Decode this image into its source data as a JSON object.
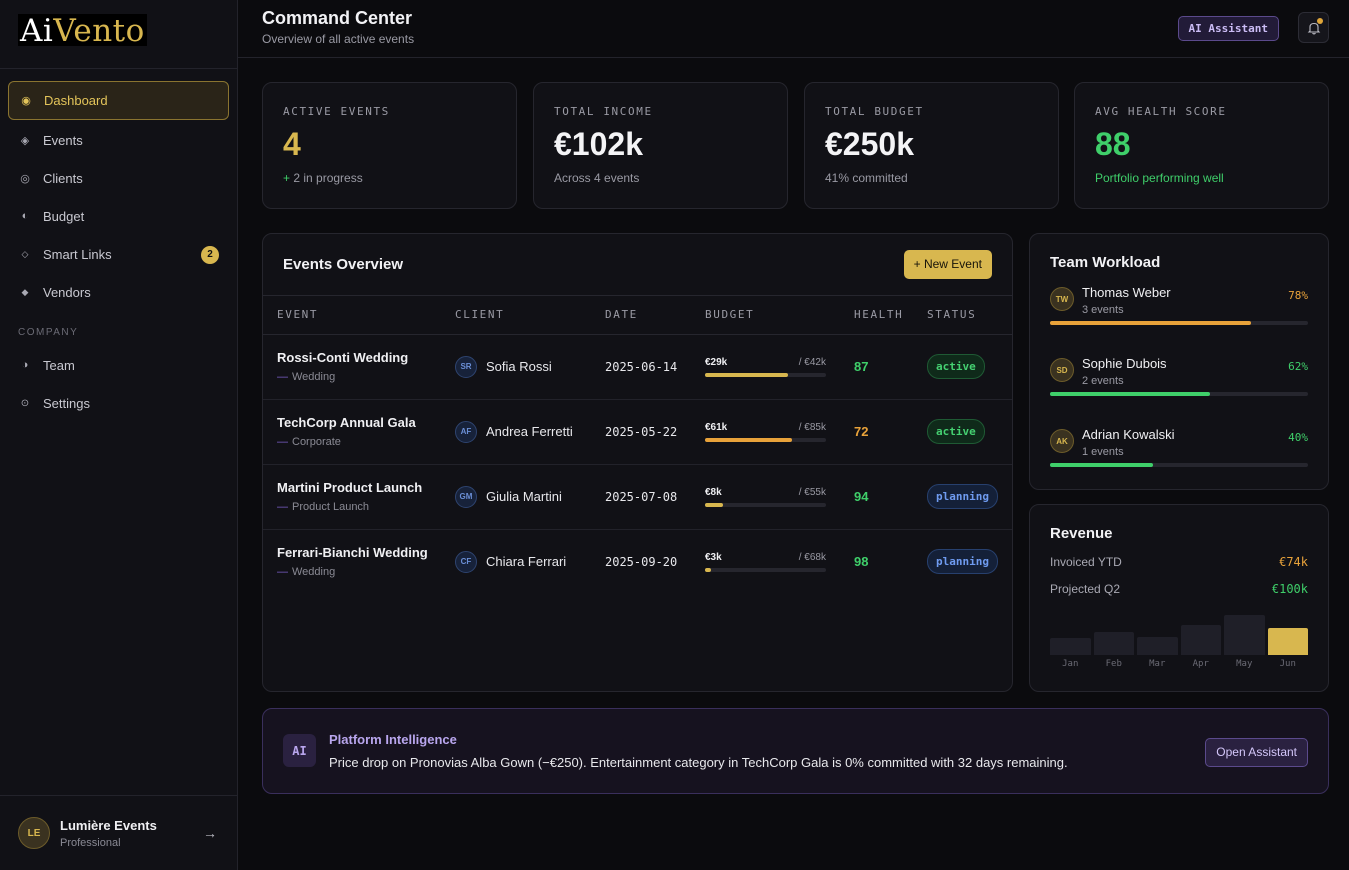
{
  "brand": {
    "logo_ai": "Ai",
    "logo_vento": "Vento"
  },
  "sidebar": {
    "items": [
      {
        "label": "Dashboard",
        "icon": "target-icon"
      },
      {
        "label": "Events",
        "icon": "diamond-icon"
      },
      {
        "label": "Clients",
        "icon": "ring-icon"
      },
      {
        "label": "Budget",
        "icon": "half-circle-icon"
      },
      {
        "label": "Smart Links",
        "icon": "diamond-outline-icon",
        "badge": "2"
      },
      {
        "label": "Vendors",
        "icon": "diamond-small-icon"
      }
    ],
    "section_company": "COMPANY",
    "company_items": [
      {
        "label": "Team",
        "icon": "half-circle-icon"
      },
      {
        "label": "Settings",
        "icon": "gear-icon"
      }
    ],
    "user": {
      "initials": "LE",
      "name": "Lumière Events",
      "plan": "Professional",
      "logout_glyph": "→"
    }
  },
  "header": {
    "title": "Command Center",
    "subtitle": "Overview of all active events",
    "ai_button": "AI Assistant"
  },
  "stats": [
    {
      "label": "ACTIVE EVENTS",
      "value": "4",
      "sub_prefix": "+",
      "sub": "2 in progress"
    },
    {
      "label": "TOTAL INCOME",
      "value": "€102k",
      "sub": "Across 4 events"
    },
    {
      "label": "TOTAL BUDGET",
      "value": "€250k",
      "sub": "41% committed"
    },
    {
      "label": "AVG HEALTH SCORE",
      "value": "88",
      "sub": "Portfolio performing well"
    }
  ],
  "events": {
    "title": "Events Overview",
    "new_button": "+ New Event",
    "columns": [
      "EVENT",
      "CLIENT",
      "DATE",
      "BUDGET",
      "HEALTH",
      "STATUS"
    ],
    "rows": [
      {
        "name": "Rossi-Conti Wedding",
        "type": "Wedding",
        "client_initials": "SR",
        "client": "Sofia Rossi",
        "date": "2025-06-14",
        "spent": "€29k",
        "total": "/ €42k",
        "pct": 0.69,
        "health": "87",
        "status": "active",
        "color": "#d8b74f"
      },
      {
        "name": "TechCorp Annual Gala",
        "type": "Corporate",
        "client_initials": "AF",
        "client": "Andrea Ferretti",
        "date": "2025-05-22",
        "spent": "€61k",
        "total": "/ €85k",
        "pct": 0.72,
        "health": "72",
        "status": "active",
        "color": "#e8a23a"
      },
      {
        "name": "Martini Product Launch",
        "type": "Product Launch",
        "client_initials": "GM",
        "client": "Giulia Martini",
        "date": "2025-07-08",
        "spent": "€8k",
        "total": "/ €55k",
        "pct": 0.15,
        "health": "94",
        "status": "planning",
        "color": "#d8b74f"
      },
      {
        "name": "Ferrari-Bianchi Wedding",
        "type": "Wedding",
        "client_initials": "CF",
        "client": "Chiara Ferrari",
        "date": "2025-09-20",
        "spent": "€3k",
        "total": "/ €68k",
        "pct": 0.05,
        "health": "98",
        "status": "planning",
        "color": "#d8b74f"
      }
    ]
  },
  "team": {
    "title": "Team Workload",
    "members": [
      {
        "initials": "TW",
        "name": "Thomas Weber",
        "sub": "3 events",
        "pct_label": "78%",
        "pct": 0.78,
        "color": "#e8a23a"
      },
      {
        "initials": "SD",
        "name": "Sophie Dubois",
        "sub": "2 events",
        "pct_label": "62%",
        "pct": 0.62,
        "color": "#3fcf6a"
      },
      {
        "initials": "AK",
        "name": "Adrian Kowalski",
        "sub": "1 events",
        "pct_label": "40%",
        "pct": 0.4,
        "color": "#3fcf6a"
      }
    ]
  },
  "revenue": {
    "title": "Revenue",
    "rows": [
      {
        "label": "Invoiced YTD",
        "value": "€74k"
      },
      {
        "label": "Projected Q2",
        "value": "€100k"
      }
    ],
    "months": [
      "Jan",
      "Feb",
      "Mar",
      "Apr",
      "May",
      "Jun"
    ],
    "levels": [
      0.4,
      0.55,
      0.42,
      0.72,
      0.95,
      0.65
    ]
  },
  "intel": {
    "badge": "AI",
    "title": "Platform Intelligence",
    "text": "Price drop on Pronovias Alba Gown (−€250). Entertainment category in TechCorp Gala is 0% committed with 32 days remaining.",
    "button": "Open Assistant"
  },
  "colors": {
    "accent": "#d8b74f",
    "good": "#3fcf6a",
    "warn": "#e8a23a",
    "ai": "#b9a6ee"
  }
}
